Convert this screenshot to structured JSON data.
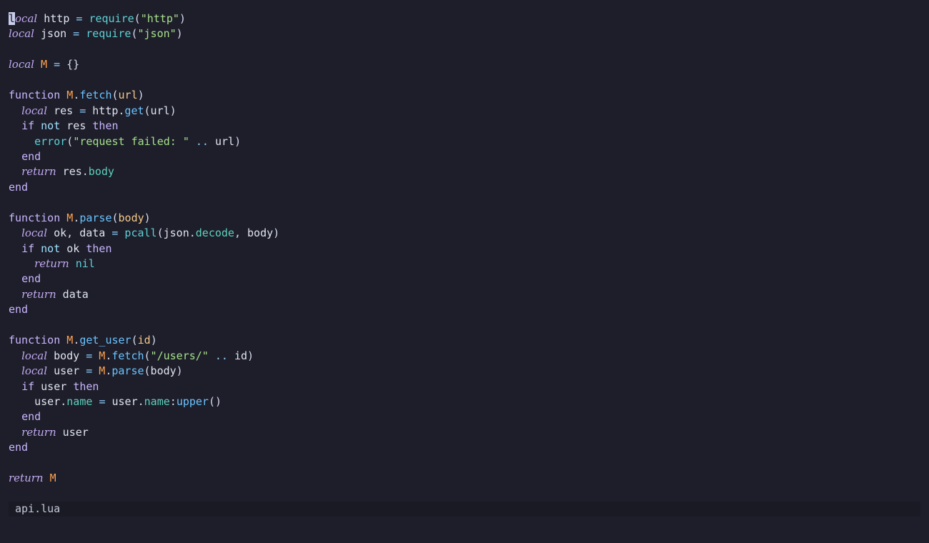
{
  "editor": {
    "filename": "api.lua",
    "language": "lua",
    "lines": [
      [
        [
          "cursor",
          "l"
        ],
        [
          "kw-italic",
          "ocal"
        ],
        [
          "plain",
          " http "
        ],
        [
          "op",
          "="
        ],
        [
          "plain",
          " "
        ],
        [
          "builtin",
          "require"
        ],
        [
          "punc",
          "("
        ],
        [
          "str",
          "\"http\""
        ],
        [
          "punc",
          ")"
        ]
      ],
      [
        [
          "kw-italic",
          "local"
        ],
        [
          "plain",
          " json "
        ],
        [
          "op",
          "="
        ],
        [
          "plain",
          " "
        ],
        [
          "builtin",
          "require"
        ],
        [
          "punc",
          "("
        ],
        [
          "str",
          "\"json\""
        ],
        [
          "punc",
          ")"
        ]
      ],
      [],
      [
        [
          "kw-italic",
          "local"
        ],
        [
          "plain",
          " "
        ],
        [
          "mod",
          "M"
        ],
        [
          "plain",
          " "
        ],
        [
          "op",
          "="
        ],
        [
          "plain",
          " "
        ],
        [
          "punc",
          "{}"
        ]
      ],
      [],
      [
        [
          "kw",
          "function"
        ],
        [
          "plain",
          " "
        ],
        [
          "mod",
          "M"
        ],
        [
          "punc",
          "."
        ],
        [
          "fn",
          "fetch"
        ],
        [
          "punc",
          "("
        ],
        [
          "param",
          "url"
        ],
        [
          "punc",
          ")"
        ]
      ],
      [
        [
          "plain",
          "  "
        ],
        [
          "kw-italic",
          "local"
        ],
        [
          "plain",
          " res "
        ],
        [
          "op",
          "="
        ],
        [
          "plain",
          " http"
        ],
        [
          "punc",
          "."
        ],
        [
          "fn",
          "get"
        ],
        [
          "punc",
          "("
        ],
        [
          "plain",
          "url"
        ],
        [
          "punc",
          ")"
        ]
      ],
      [
        [
          "plain",
          "  "
        ],
        [
          "kw",
          "if"
        ],
        [
          "plain",
          " "
        ],
        [
          "kw-not",
          "not"
        ],
        [
          "plain",
          " res "
        ],
        [
          "kw",
          "then"
        ]
      ],
      [
        [
          "plain",
          "    "
        ],
        [
          "builtin",
          "error"
        ],
        [
          "punc",
          "("
        ],
        [
          "str",
          "\"request failed: \""
        ],
        [
          "plain",
          " "
        ],
        [
          "op",
          ".."
        ],
        [
          "plain",
          " url"
        ],
        [
          "punc",
          ")"
        ]
      ],
      [
        [
          "plain",
          "  "
        ],
        [
          "kw",
          "end"
        ]
      ],
      [
        [
          "plain",
          "  "
        ],
        [
          "kw-italic",
          "return"
        ],
        [
          "plain",
          " res"
        ],
        [
          "punc",
          "."
        ],
        [
          "prop",
          "body"
        ]
      ],
      [
        [
          "kw",
          "end"
        ]
      ],
      [],
      [
        [
          "kw",
          "function"
        ],
        [
          "plain",
          " "
        ],
        [
          "mod",
          "M"
        ],
        [
          "punc",
          "."
        ],
        [
          "fn",
          "parse"
        ],
        [
          "punc",
          "("
        ],
        [
          "param",
          "body"
        ],
        [
          "punc",
          ")"
        ]
      ],
      [
        [
          "plain",
          "  "
        ],
        [
          "kw-italic",
          "local"
        ],
        [
          "plain",
          " ok"
        ],
        [
          "punc",
          ","
        ],
        [
          "plain",
          " data "
        ],
        [
          "op",
          "="
        ],
        [
          "plain",
          " "
        ],
        [
          "builtin",
          "pcall"
        ],
        [
          "punc",
          "("
        ],
        [
          "plain",
          "json"
        ],
        [
          "punc",
          "."
        ],
        [
          "prop",
          "decode"
        ],
        [
          "punc",
          ","
        ],
        [
          "plain",
          " body"
        ],
        [
          "punc",
          ")"
        ]
      ],
      [
        [
          "plain",
          "  "
        ],
        [
          "kw",
          "if"
        ],
        [
          "plain",
          " "
        ],
        [
          "kw-not",
          "not"
        ],
        [
          "plain",
          " ok "
        ],
        [
          "kw",
          "then"
        ]
      ],
      [
        [
          "plain",
          "    "
        ],
        [
          "kw-italic",
          "return"
        ],
        [
          "plain",
          " "
        ],
        [
          "nil",
          "nil"
        ]
      ],
      [
        [
          "plain",
          "  "
        ],
        [
          "kw",
          "end"
        ]
      ],
      [
        [
          "plain",
          "  "
        ],
        [
          "kw-italic",
          "return"
        ],
        [
          "plain",
          " data"
        ]
      ],
      [
        [
          "kw",
          "end"
        ]
      ],
      [],
      [
        [
          "kw",
          "function"
        ],
        [
          "plain",
          " "
        ],
        [
          "mod",
          "M"
        ],
        [
          "punc",
          "."
        ],
        [
          "fn",
          "get_user"
        ],
        [
          "punc",
          "("
        ],
        [
          "param",
          "id"
        ],
        [
          "punc",
          ")"
        ]
      ],
      [
        [
          "plain",
          "  "
        ],
        [
          "kw-italic",
          "local"
        ],
        [
          "plain",
          " body "
        ],
        [
          "op",
          "="
        ],
        [
          "plain",
          " "
        ],
        [
          "mod",
          "M"
        ],
        [
          "punc",
          "."
        ],
        [
          "fn",
          "fetch"
        ],
        [
          "punc",
          "("
        ],
        [
          "str",
          "\"/users/\""
        ],
        [
          "plain",
          " "
        ],
        [
          "op",
          ".."
        ],
        [
          "plain",
          " id"
        ],
        [
          "punc",
          ")"
        ]
      ],
      [
        [
          "plain",
          "  "
        ],
        [
          "kw-italic",
          "local"
        ],
        [
          "plain",
          " user "
        ],
        [
          "op",
          "="
        ],
        [
          "plain",
          " "
        ],
        [
          "mod",
          "M"
        ],
        [
          "punc",
          "."
        ],
        [
          "fn",
          "parse"
        ],
        [
          "punc",
          "("
        ],
        [
          "plain",
          "body"
        ],
        [
          "punc",
          ")"
        ]
      ],
      [
        [
          "plain",
          "  "
        ],
        [
          "kw",
          "if"
        ],
        [
          "plain",
          " user "
        ],
        [
          "kw",
          "then"
        ]
      ],
      [
        [
          "plain",
          "    user"
        ],
        [
          "punc",
          "."
        ],
        [
          "prop",
          "name"
        ],
        [
          "plain",
          " "
        ],
        [
          "op",
          "="
        ],
        [
          "plain",
          " user"
        ],
        [
          "punc",
          "."
        ],
        [
          "prop",
          "name"
        ],
        [
          "punc",
          ":"
        ],
        [
          "fn",
          "upper"
        ],
        [
          "punc",
          "()"
        ]
      ],
      [
        [
          "plain",
          "  "
        ],
        [
          "kw",
          "end"
        ]
      ],
      [
        [
          "plain",
          "  "
        ],
        [
          "kw-italic",
          "return"
        ],
        [
          "plain",
          " user"
        ]
      ],
      [
        [
          "kw",
          "end"
        ]
      ],
      [],
      [
        [
          "kw-italic",
          "return"
        ],
        [
          "plain",
          " "
        ],
        [
          "mod",
          "M"
        ]
      ]
    ]
  },
  "statusbar": {
    "filename": "api.lua"
  },
  "colors": {
    "background": "#1d1e2a",
    "statusbar_background": "#191a24",
    "keyword": "#c3a9f0",
    "function": "#6bc3ff",
    "builtin": "#5ed0d4",
    "string": "#a6e08a",
    "module": "#ffa14f",
    "parameter": "#f5c98c",
    "property": "#5ed0bd"
  }
}
